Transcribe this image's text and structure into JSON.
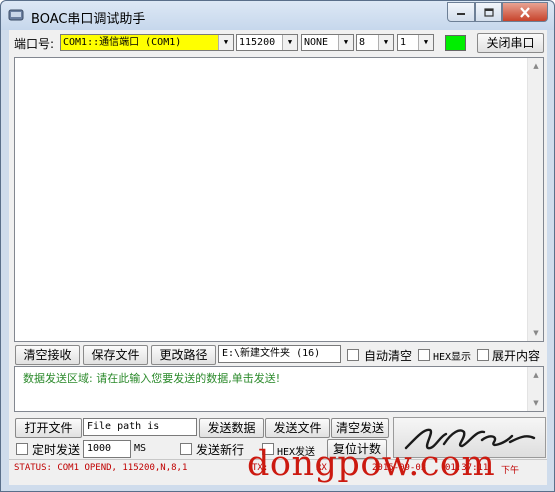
{
  "window": {
    "title": "BOAC串口调试助手",
    "min_icon": "minimize-icon",
    "max_icon": "maximize-icon",
    "close_icon": "close-icon"
  },
  "toolbar": {
    "port_label": "端口号:",
    "port_value": "COM1::通信端口 (COM1)",
    "baud_value": "115200",
    "parity_value": "NONE",
    "databits_value": "8",
    "stopbits_value": "1",
    "indicator_color": "#00ee00",
    "close_port_label": "关闭串口"
  },
  "receive_actions": {
    "clear_label": "清空接收",
    "save_label": "保存文件",
    "change_path_label": "更改路径",
    "path_value": "E:\\新建文件夹 (16)",
    "auto_clear_label": "自动清空",
    "hex_display_label": "HEX显示",
    "expand_label": "展开内容"
  },
  "send_area": {
    "prompt": "数据发送区域: 请在此输入您要发送的数据,单击发送!",
    "prompt_color": "#2b8a2b"
  },
  "send_actions": {
    "open_file_label": "打开文件",
    "file_path_value": "File path is",
    "send_data_label": "发送数据",
    "send_file_label": "发送文件",
    "clear_send_label": "清空发送",
    "timed_send_label": "定时发送",
    "interval_value": "1000",
    "interval_unit": "MS",
    "send_newline_label": "发送新行",
    "hex_send_label": "HEX发送",
    "reset_count_label": "复位计数"
  },
  "status_bar": {
    "status_text": "STATUS: COM1 OPEND, 115200,N,8,1",
    "tx_text": "TX:",
    "rx_text": "RX",
    "date_text": "2015-09-03",
    "time_text": "01:37:11",
    "ampm_text": "下午"
  },
  "watermark": {
    "text": "dongpow.com"
  }
}
